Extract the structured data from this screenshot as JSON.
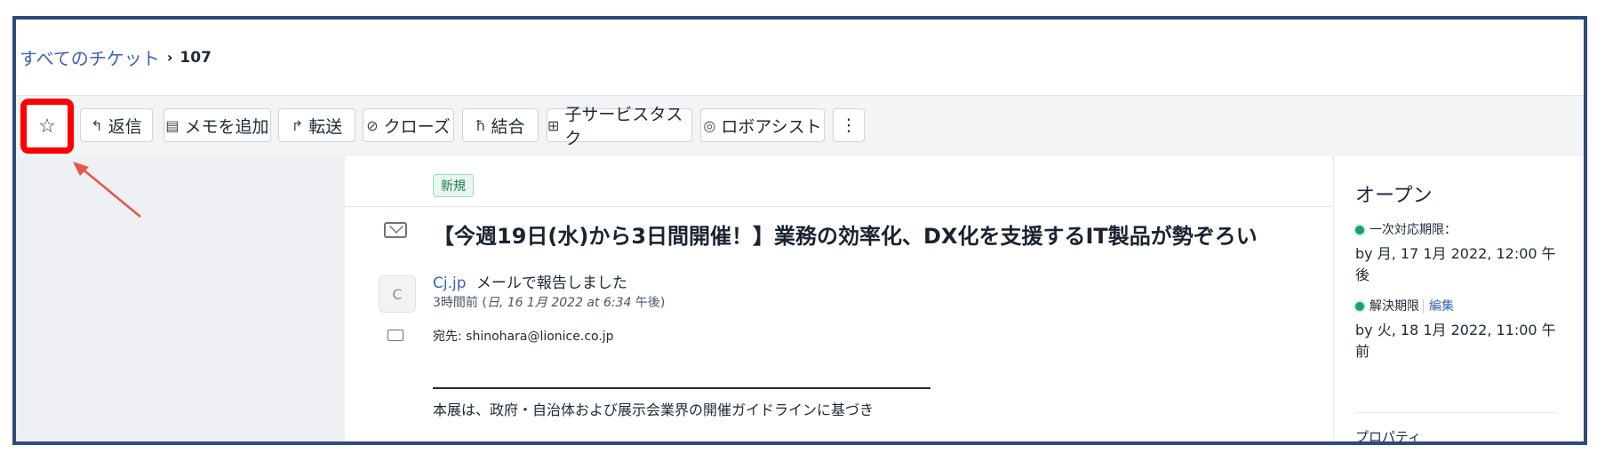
{
  "breadcrumb": {
    "all_tickets": "すべてのチケット",
    "separator": "›",
    "ticket_id": "107"
  },
  "toolbar": {
    "reply": "返信",
    "add_note": "メモを追加",
    "forward": "転送",
    "close": "クローズ",
    "merge": "結合",
    "child_task": "子サービスタスク",
    "robo_assist": "ロボアシスト",
    "more": "⋮"
  },
  "ticket": {
    "status_badge": "新規",
    "subject": "【今週19日(水)から3日間開催！】業務の効率化、DX化を支援するIT製品が勢ぞろい",
    "avatar_letter": "C",
    "sender_name": "Cj.jp",
    "sender_action": "メールで報告しました",
    "time_prefix": "3時間前 (",
    "time_date": "日, 16 1月 2022 at 6:34",
    "time_suffix": "午後)",
    "to_line": "宛先: shinohara@lionice.co.jp",
    "body_cut": "本展は、政府・自治体および展示会業界の開催ガイドラインに基づき"
  },
  "sidebar_right": {
    "status": "オープン",
    "first_response_label": "一次対応期限：",
    "first_response_value": "by 月, 17 1月 2022, 12:00 午後",
    "resolution_label": "解決期限",
    "resolution_edit": "編集",
    "resolution_value": "by 火, 18 1月 2022, 11:00 午前",
    "properties": "プロパティ"
  },
  "colors": {
    "frame": "#2f4a7d",
    "highlight": "#ff0000",
    "arrow": "#e8534a",
    "link": "#3b63b8",
    "status_dot": "#1aa06d"
  }
}
